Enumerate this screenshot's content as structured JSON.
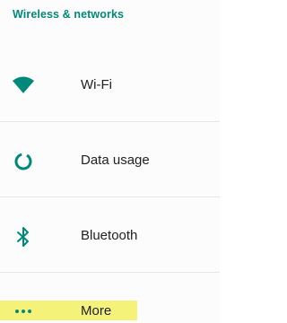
{
  "section": {
    "title": "Wireless & networks"
  },
  "items": [
    {
      "label": "Wi-Fi",
      "icon": "wifi-icon"
    },
    {
      "label": "Data usage",
      "icon": "data-usage-icon"
    },
    {
      "label": "Bluetooth",
      "icon": "bluetooth-icon"
    },
    {
      "label": "More",
      "icon": "more-icon"
    }
  ],
  "colors": {
    "accent": "#00897b",
    "highlight": "#f5f27a",
    "text": "#212121",
    "divider": "#e6e6e6"
  }
}
